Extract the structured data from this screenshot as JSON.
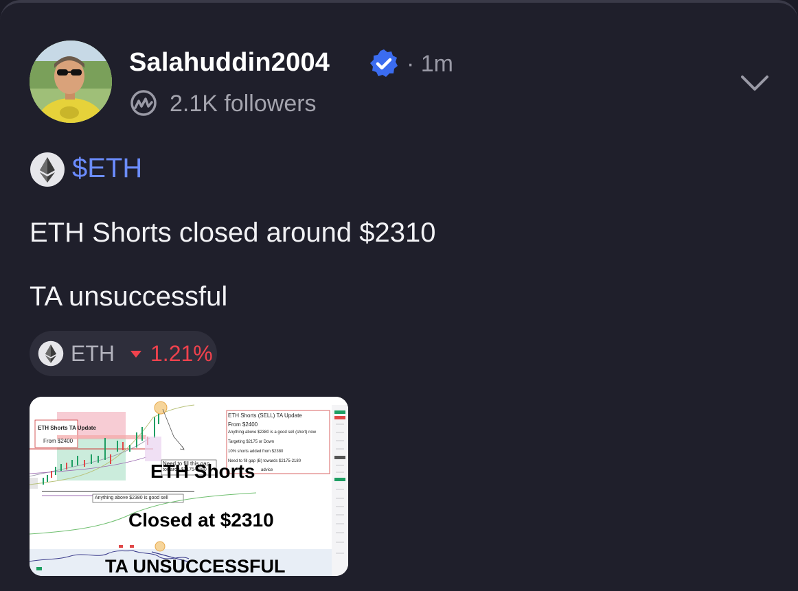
{
  "post": {
    "author": {
      "username": "Salahuddin2004",
      "verified": true,
      "time": "· 1m",
      "followers": "2.1K followers",
      "avatar_icon": "avatar-photo",
      "platform_icon": "coinmarketcap-icon"
    },
    "cashtag": "$ETH",
    "body": [
      "ETH Shorts closed around $2310",
      "TA unsuccessful"
    ],
    "ticker": {
      "symbol": "ETH",
      "change": "1.21%",
      "direction": "down",
      "change_color": "#f0424d"
    },
    "image": {
      "overlay_title": "ETH Shorts",
      "overlay_subtitle": "Closed at $2310",
      "overlay_footer": "TA UNSUCCESSFUL",
      "box_left_title": "ETH Shorts TA Update",
      "box_left_sub": "From $2400",
      "note_right": [
        "ETH Shorts (SELL) TA Update",
        "From $2400",
        "Anything above $2380 is a good sell (short) now",
        "Targeting $2175 or Down",
        "10% shorts added from $2380",
        "Need to fill gap (B) towards $2175-2180",
        "advice"
      ],
      "gap_note": "Need to fill this gap",
      "gap_note_2": "towards $2175-2180",
      "sell_note": "Anything above $2380 is good sell"
    }
  },
  "colors": {
    "background": "#1f1f2b",
    "accent_link": "#6b8cff",
    "verified_badge": "#3b6cf0",
    "down_red": "#f0424d"
  }
}
